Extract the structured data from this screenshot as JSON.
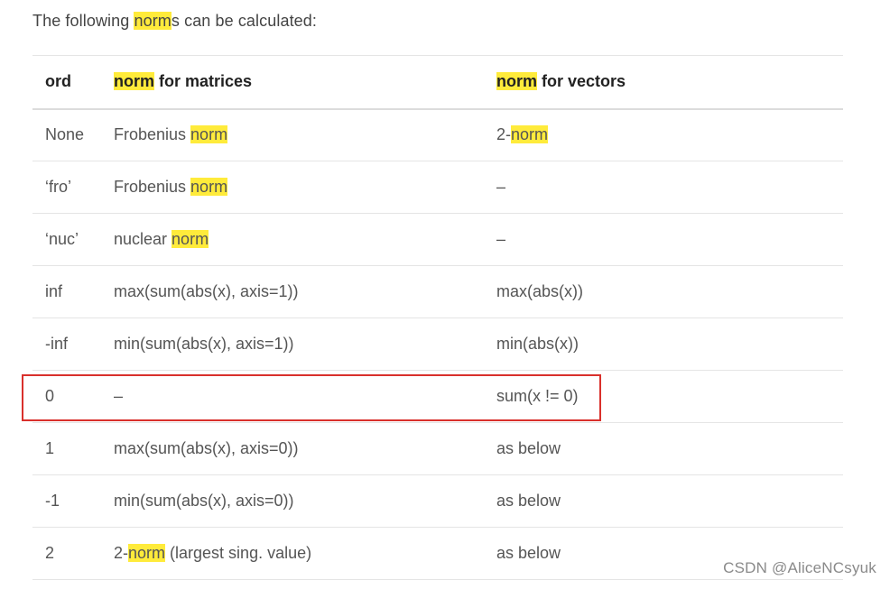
{
  "intro": {
    "before": "The following ",
    "highlight": "norm",
    "after": "s can be calculated:"
  },
  "table": {
    "headers": {
      "ord": "ord",
      "matrices_hl": "norm",
      "matrices_rest": " for matrices",
      "vectors_hl": "norm",
      "vectors_rest": " for vectors"
    },
    "rows": [
      {
        "ord": "None",
        "matrix": {
          "pre": "Frobenius ",
          "hl": "norm",
          "post": ""
        },
        "vector": {
          "pre": "2-",
          "hl": "norm",
          "post": ""
        }
      },
      {
        "ord": "‘fro’",
        "matrix": {
          "pre": "Frobenius ",
          "hl": "norm",
          "post": ""
        },
        "vector": {
          "pre": "–",
          "hl": "",
          "post": ""
        }
      },
      {
        "ord": "‘nuc’",
        "matrix": {
          "pre": "nuclear ",
          "hl": "norm",
          "post": ""
        },
        "vector": {
          "pre": "–",
          "hl": "",
          "post": ""
        }
      },
      {
        "ord": "inf",
        "matrix": {
          "pre": "max(sum(abs(x), axis=1))",
          "hl": "",
          "post": ""
        },
        "vector": {
          "pre": "max(abs(x))",
          "hl": "",
          "post": ""
        }
      },
      {
        "ord": "-inf",
        "matrix": {
          "pre": "min(sum(abs(x), axis=1))",
          "hl": "",
          "post": ""
        },
        "vector": {
          "pre": "min(abs(x))",
          "hl": "",
          "post": ""
        }
      },
      {
        "ord": "0",
        "matrix": {
          "pre": "–",
          "hl": "",
          "post": ""
        },
        "vector": {
          "pre": "sum(x != 0)",
          "hl": "",
          "post": ""
        }
      },
      {
        "ord": "1",
        "matrix": {
          "pre": "max(sum(abs(x), axis=0))",
          "hl": "",
          "post": ""
        },
        "vector": {
          "pre": "as below",
          "hl": "",
          "post": ""
        }
      },
      {
        "ord": "-1",
        "matrix": {
          "pre": "min(sum(abs(x), axis=0))",
          "hl": "",
          "post": ""
        },
        "vector": {
          "pre": "as below",
          "hl": "",
          "post": ""
        }
      },
      {
        "ord": "2",
        "matrix": {
          "pre": "2-",
          "hl": "norm",
          "post": " (largest sing. value)"
        },
        "vector": {
          "pre": "as below",
          "hl": "",
          "post": ""
        }
      }
    ]
  },
  "watermark": "CSDN @AliceNCsyuk",
  "colors": {
    "highlight": "#ffeb3b",
    "annotation_box": "#d9302c"
  }
}
